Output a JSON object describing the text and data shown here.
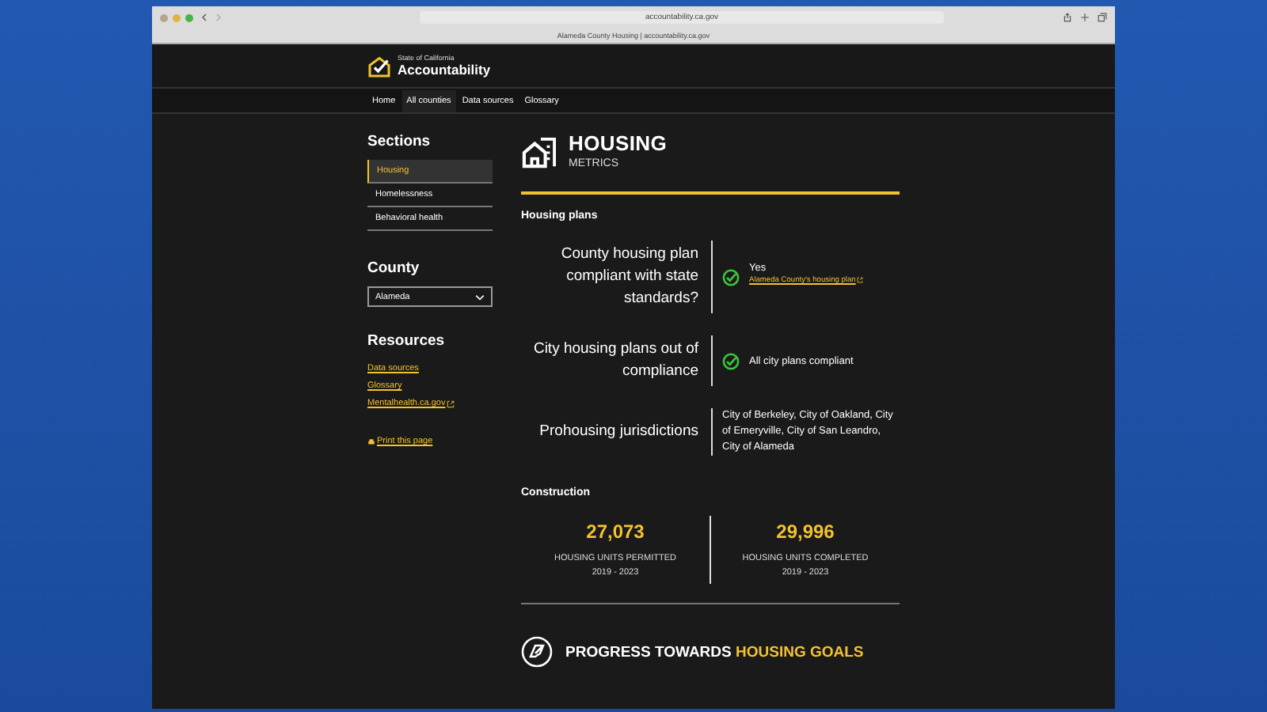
{
  "browser": {
    "url": "accountability.ca.gov",
    "tab_title": "Alameda County Housing | accountability.ca.gov"
  },
  "header": {
    "kicker": "State of California",
    "title": "Accountability"
  },
  "nav": [
    {
      "label": "Home",
      "selected": false
    },
    {
      "label": "All counties",
      "selected": true
    },
    {
      "label": "Data sources",
      "selected": false
    },
    {
      "label": "Glossary",
      "selected": false
    }
  ],
  "sidebar": {
    "sections_title": "Sections",
    "sections": [
      {
        "label": "Housing",
        "selected": true
      },
      {
        "label": "Homelessness",
        "selected": false
      },
      {
        "label": "Behavioral health",
        "selected": false
      }
    ],
    "county": {
      "title": "County",
      "value": "Alameda"
    },
    "resources": {
      "title": "Resources",
      "links": [
        {
          "label": "Data sources",
          "external": false
        },
        {
          "label": "Glossary",
          "external": false
        },
        {
          "label": "Mentalhealth.ca.gov",
          "external": true
        }
      ]
    },
    "print_link": "Print this page"
  },
  "main": {
    "title": "HOUSING",
    "subtitle": "METRICS",
    "housing_plans": {
      "title": "Housing plans",
      "rows": [
        {
          "label": "County housing plan compliant with state standards?",
          "kind": "check",
          "value": "Yes",
          "link": "Alameda County's housing plan"
        },
        {
          "label": "City housing plans out of compliance",
          "kind": "check",
          "value": "All city plans compliant"
        },
        {
          "label": "Prohousing jurisdictions",
          "kind": "text",
          "value": "City of Berkeley, City of Oakland, City of Emeryville, City of San Leandro, City of Alameda"
        }
      ]
    },
    "construction": {
      "title": "Construction",
      "stats": [
        {
          "value": "27,073",
          "label": "HOUSING UNITS PERMITTED",
          "period": "2019 - 2023"
        },
        {
          "value": "29,996",
          "label": "HOUSING UNITS COMPLETED",
          "period": "2019 - 2023"
        }
      ]
    },
    "progress": {
      "prefix": "PROGRESS TOWARDS",
      "highlight": "HOUSING GOALS"
    }
  }
}
